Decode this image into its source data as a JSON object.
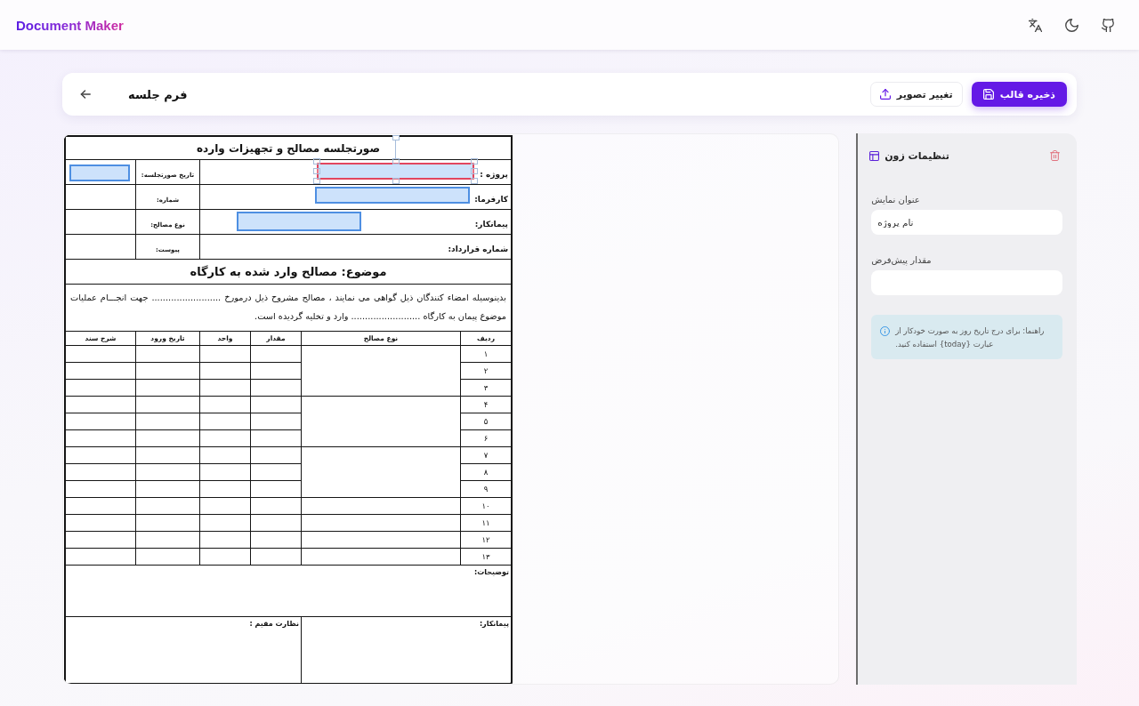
{
  "app": {
    "logo": "Document Maker"
  },
  "toolbar": {
    "title": "فرم جلسه",
    "buttons": [
      {
        "kind": "primary",
        "label": "ذخیره قالب"
      },
      {
        "kind": "secondary",
        "label": "تغییر تصویر"
      }
    ]
  },
  "document": {
    "title": "صورتجلسه مصالح و تجهیزات وارده",
    "info_rows": [
      {
        "label": "پروژه :",
        "zone": {
          "selected": true
        },
        "side_label": "تاریخ صورتجلسه:",
        "side_zone": {
          "selected": false
        }
      },
      {
        "label": "کارفرما:",
        "zone": {
          "selected": false
        },
        "side_label": "شماره:"
      },
      {
        "label": "پیمانکار:",
        "zone": {
          "selected": false
        },
        "side_label": "نوع مصالح:"
      },
      {
        "label": "شماره قرارداد:",
        "side_label": "پیوست:"
      }
    ],
    "subject": "موضوع: مصالح وارد شده به کارگاه",
    "paragraph": "بدینوسیله امضاء کنندگان ذیل گواهی می نمایند ، مصالح مشروح ذیل درمورخ ......................... جهت انجـــام عملیات موضوع پیمان به کارگاه ......................... وارد و تخلیه گردیده است.",
    "table": {
      "columns": [
        "ردیف",
        "نوع مصالح",
        "مقدار",
        "واحد",
        "تاریخ ورود",
        "شرح سند"
      ],
      "rows": [
        "۱",
        "۲",
        "۳",
        "۴",
        "۵",
        "۶",
        "۷",
        "۸",
        "۹",
        "۱۰",
        "۱۱",
        "۱۲",
        "۱۳"
      ]
    },
    "notes_label": "توضیحات:",
    "signatures": [
      "پیمانکار:",
      "نظارت مقیم :"
    ]
  },
  "zone_settings": {
    "title": "تنظیمات زون",
    "fields": [
      {
        "label": "عنوان نمایش",
        "value": "نام پروژه"
      },
      {
        "label": "مقدار پیش‌فرض"
      }
    ],
    "hint": "راهنما: برای درج تاریخ روز به صورت خودکار از عبارت {today} استفاده کنید."
  }
}
